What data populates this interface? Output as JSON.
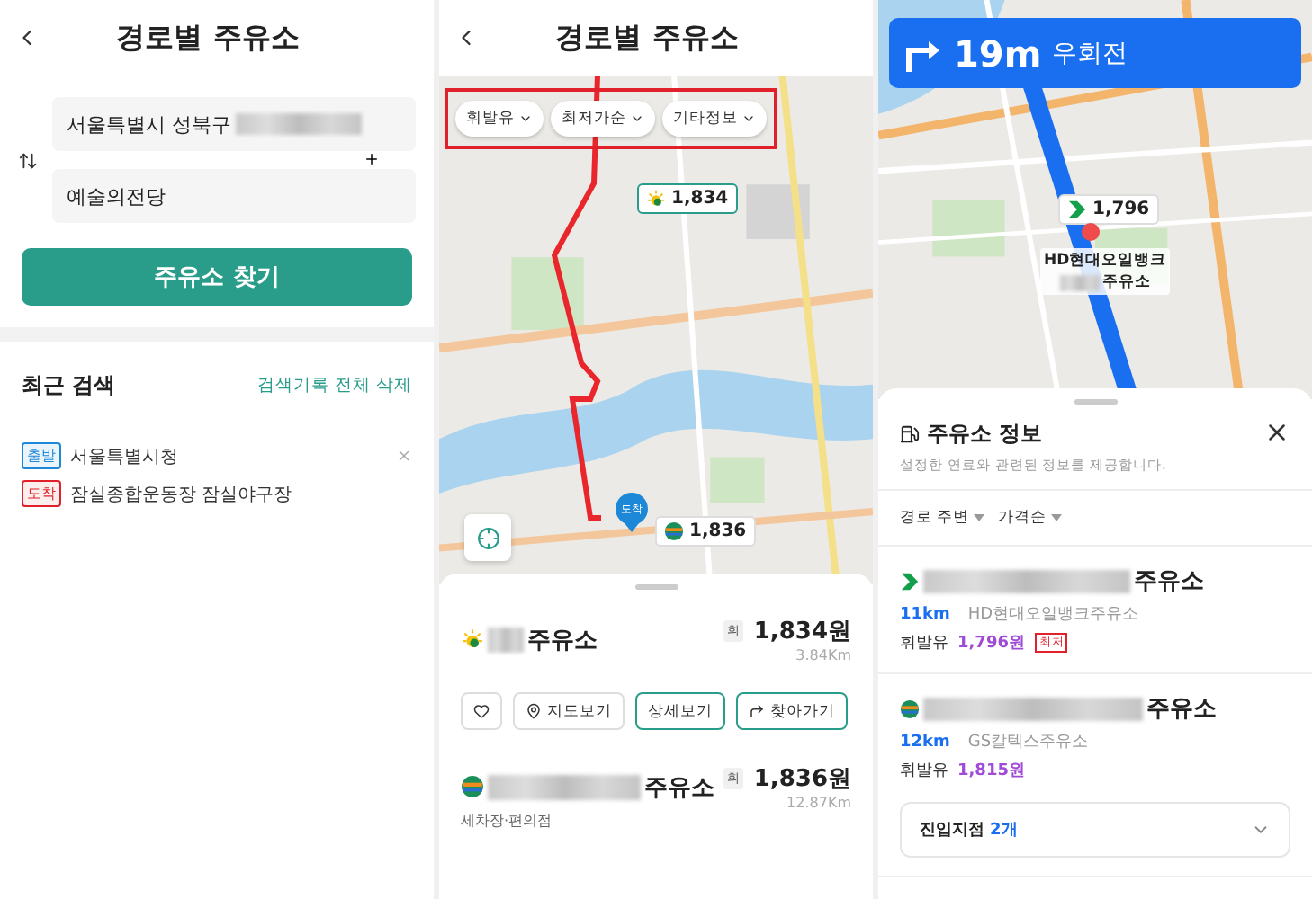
{
  "route_search": {
    "title": "경로별 주유소",
    "origin": "서울특별시 성북구",
    "destination": "예술의전당",
    "search_button": "주유소 찾기",
    "recent_title": "최근 검색",
    "clear_all": "검색기록 전체 삭제",
    "recent": [
      {
        "kind": "start",
        "tag": "출발",
        "text": "서울특별시청"
      },
      {
        "kind": "end",
        "tag": "도착",
        "text": "잠실종합운동장 잠실야구장"
      }
    ]
  },
  "route_map": {
    "title": "경로별 주유소",
    "filters_highlighted": true,
    "filters": [
      "휘발유",
      "최저가순",
      "기타정보"
    ],
    "pins": [
      {
        "kind": "sun",
        "price": "1,834"
      },
      {
        "kind": "gs",
        "price": "1,836"
      }
    ],
    "arrival_pin": "도착",
    "stations": [
      {
        "kind": "sun",
        "name": "주유소",
        "fuel": "휘",
        "price": "1,834원",
        "distance": "3.84Km",
        "actions": [
          {
            "kind": "favorite"
          },
          {
            "kind": "map",
            "label": "지도보기"
          },
          {
            "kind": "detail",
            "label": "상세보기"
          },
          {
            "kind": "route",
            "label": "찾아가기"
          }
        ]
      },
      {
        "kind": "gs",
        "name": "주유소",
        "fuel": "휘",
        "price": "1,836원",
        "distance": "12.87Km",
        "note": "세차장·편의점"
      }
    ]
  },
  "navigation": {
    "distance": "19m",
    "maneuver": "우회전",
    "pin": {
      "kind": "hd",
      "price": "1,796"
    },
    "marker_label": [
      "HD현대오일뱅크",
      "주유소"
    ],
    "sheet": {
      "title": "주유소 정보",
      "subtitle": "설정한 연료와 관련된 정보를 제공합니다.",
      "sorts": [
        "경로 주변",
        "가격순"
      ],
      "stations": [
        {
          "kind": "hd",
          "name": "주유소",
          "distance": "11km",
          "brand": "HD현대오일뱅크주유소",
          "fuel": "휘발유",
          "price": "1,796원",
          "badge": "최저"
        },
        {
          "kind": "gs",
          "name": "주유소",
          "distance": "12km",
          "brand": "GS칼텍스주유소",
          "fuel": "휘발유",
          "price": "1,815원",
          "entry": {
            "label": "진입지점",
            "count": "2개",
            "expanded": false
          }
        }
      ]
    }
  }
}
